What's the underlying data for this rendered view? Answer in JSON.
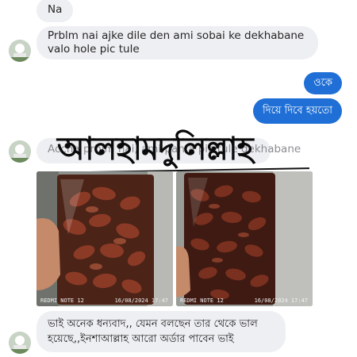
{
  "messages": {
    "m1": "Na",
    "m2_line1": "Prblm nai ajke dile den ami sobai ke dekhabane",
    "m2_line2": "valo hole pic tule",
    "out1": "ওকে",
    "out2": "দিয়ে দিবে হয়তো",
    "m3_faded": "Accha prblm nai, ami pan a pic tule dekhabane",
    "overlay": "আলহামদুলিল্লাহ",
    "m4_line1": "ভাই অনেক ধন্যবাদ,, যেমন বলছেন তার থেকে ভাল",
    "m4_line2": "হয়েছে,,ইনশাআল্লাহ আরো অর্ডার পাবেন ভাই"
  },
  "photos": {
    "left_caption_left": "REDMI NOTE 12",
    "left_caption_right": "16/08/2024 17:47",
    "right_caption_left": "REDMI NOTE 12",
    "right_caption_right": "16/08/2024 17:47"
  },
  "colors": {
    "outgoing_bubble": "#1f6fd6",
    "incoming_bubble": "#eeeff2",
    "dates_dark": "#4a1d14",
    "dates_light": "#8b3a26"
  }
}
